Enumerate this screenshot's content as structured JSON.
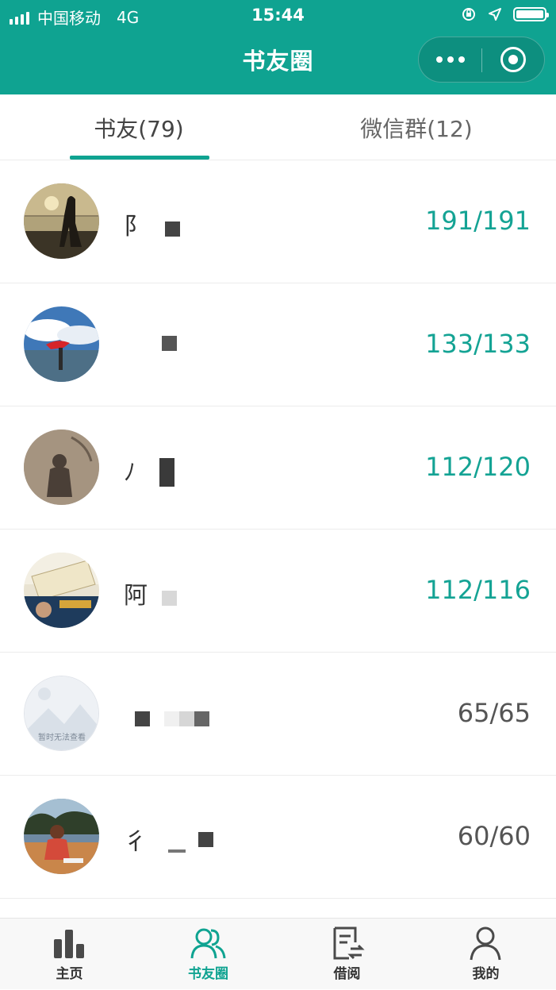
{
  "status_bar": {
    "carrier": "中国移动",
    "network": "4G",
    "time": "15:44"
  },
  "nav": {
    "title": "书友圈"
  },
  "tabs": [
    {
      "label": "书友(79)",
      "active": true
    },
    {
      "label": "微信群(12)",
      "active": false
    }
  ],
  "friends": [
    {
      "name": "阝",
      "count": "191/191",
      "highlight": true
    },
    {
      "name": "",
      "count": "133/133",
      "highlight": true
    },
    {
      "name": "ﾉ",
      "count": "112/120",
      "highlight": true
    },
    {
      "name": "阿",
      "count": "112/116",
      "highlight": true
    },
    {
      "name": "",
      "count": "65/65",
      "highlight": false,
      "avatar_caption": "暂时无法查看"
    },
    {
      "name": "彳",
      "count": "60/60",
      "highlight": false
    }
  ],
  "tabbar": [
    {
      "label": "主页",
      "icon": "bar-chart-icon"
    },
    {
      "label": "书友圈",
      "icon": "people-icon",
      "active": true
    },
    {
      "label": "借阅",
      "icon": "borrow-document-icon"
    },
    {
      "label": "我的",
      "icon": "person-icon"
    }
  ],
  "colors": {
    "accent": "#0fa391",
    "count_highlight": "#14a394",
    "count_normal": "#555555"
  }
}
